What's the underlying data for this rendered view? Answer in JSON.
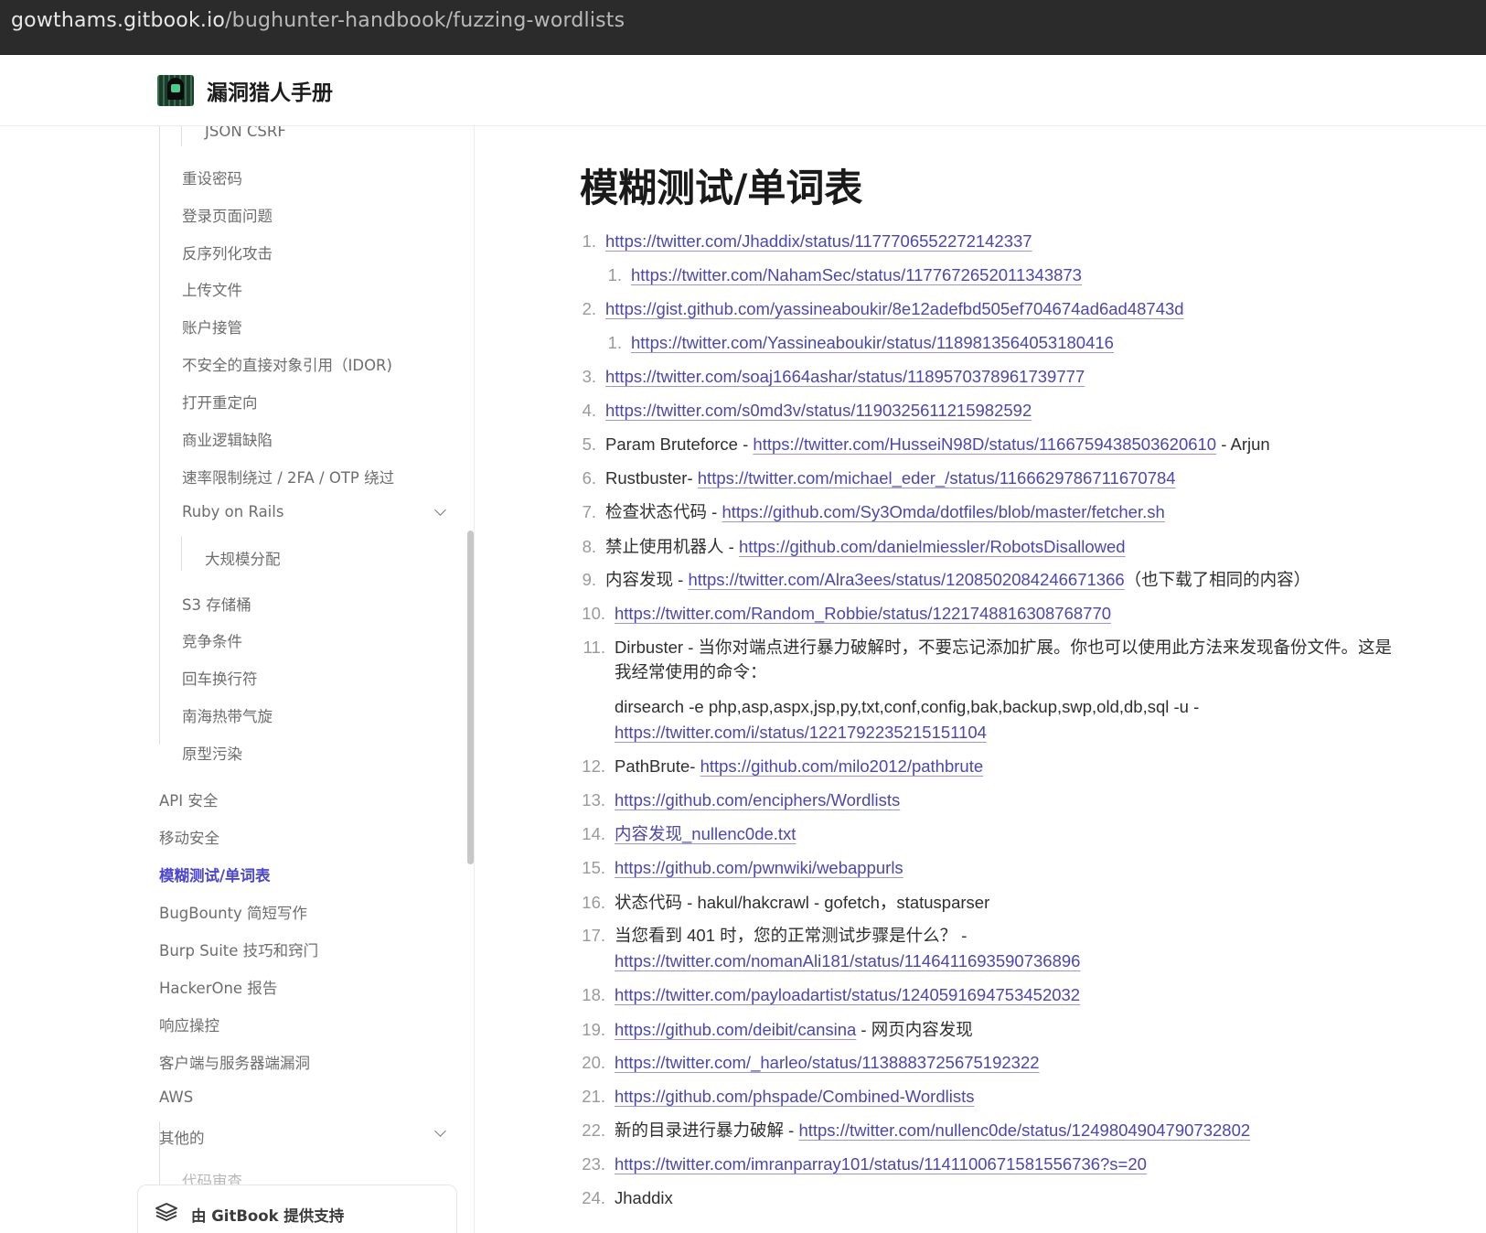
{
  "browser": {
    "url_host": "gowthams.gitbook.io",
    "url_path": "/bughunter-handbook/fuzzing-wordlists"
  },
  "header": {
    "logo_icon": "hooded-hacker-logo-icon",
    "site_title": "漏洞猎人手册"
  },
  "sidebar": {
    "items": [
      {
        "label": "JSON CSRF"
      },
      {
        "label": "重设密码"
      },
      {
        "label": "登录页面问题"
      },
      {
        "label": "反序列化攻击"
      },
      {
        "label": "上传文件"
      },
      {
        "label": "账户接管"
      },
      {
        "label": "不安全的直接对象引用（IDOR)"
      },
      {
        "label": "打开重定向"
      },
      {
        "label": "商业逻辑缺陷"
      },
      {
        "label": "速率限制绕过 / 2FA / OTP 绕过"
      },
      {
        "label": "Ruby on Rails"
      },
      {
        "label": "大规模分配"
      },
      {
        "label": "S3 存储桶"
      },
      {
        "label": "竞争条件"
      },
      {
        "label": "回车换行符"
      },
      {
        "label": "南海热带气旋"
      },
      {
        "label": "原型污染"
      },
      {
        "label": "API 安全"
      },
      {
        "label": "移动安全"
      },
      {
        "label": "模糊测试/单词表"
      },
      {
        "label": "BugBounty 简短写作"
      },
      {
        "label": "Burp Suite 技巧和窍门"
      },
      {
        "label": "HackerOne 报告"
      },
      {
        "label": "响应操控"
      },
      {
        "label": "客户端与服务器端漏洞"
      },
      {
        "label": "AWS"
      },
      {
        "label": "其他的"
      },
      {
        "label": "代码审查"
      }
    ],
    "powered_by": "由 GitBook 提供支持"
  },
  "main": {
    "title": "模糊测试/单词表",
    "list": [
      {
        "n": "1.",
        "parts": [
          {
            "link": "https://twitter.com/Jhaddix/status/1177706552272142337"
          }
        ]
      },
      {
        "n": "1.",
        "sub": true,
        "parts": [
          {
            "link": "https://twitter.com/NahamSec/status/1177672652011343873"
          }
        ]
      },
      {
        "n": "2.",
        "parts": [
          {
            "link": "https://gist.github.com/yassineaboukir/8e12adefbd505ef704674ad6ad48743d"
          }
        ]
      },
      {
        "n": "1.",
        "sub": true,
        "parts": [
          {
            "link": "https://twitter.com/Yassineaboukir/status/1189813564053180416"
          }
        ]
      },
      {
        "n": "3.",
        "parts": [
          {
            "link": "https://twitter.com/soaj1664ashar/status/1189570378961739777"
          }
        ]
      },
      {
        "n": "4.",
        "parts": [
          {
            "link": "https://twitter.com/s0md3v/status/1190325611215982592"
          }
        ]
      },
      {
        "n": "5.",
        "parts": [
          {
            "text": "Param Bruteforce - "
          },
          {
            "link": "https://twitter.com/HusseiN98D/status/1166759438503620610"
          },
          {
            "text": " - Arjun"
          }
        ]
      },
      {
        "n": "6.",
        "parts": [
          {
            "text": "Rustbuster- "
          },
          {
            "link": "https://twitter.com/michael_eder_/status/1166629786711670784"
          }
        ]
      },
      {
        "n": "7.",
        "parts": [
          {
            "text": "检查状态代码 - "
          },
          {
            "link": "https://github.com/Sy3Omda/dotfiles/blob/master/fetcher.sh"
          }
        ]
      },
      {
        "n": "8.",
        "parts": [
          {
            "text": "禁止使用机器人 - "
          },
          {
            "link": "https://github.com/danielmiessler/RobotsDisallowed"
          }
        ]
      },
      {
        "n": "9.",
        "parts": [
          {
            "text": "内容发现 - "
          },
          {
            "link": "https://twitter.com/Alra3ees/status/1208502084246671366"
          },
          {
            "text": "（也下载了相同的内容）"
          }
        ]
      },
      {
        "n": "10.",
        "parts": [
          {
            "link": "https://twitter.com/Random_Robbie/status/1221748816308768770"
          }
        ]
      },
      {
        "n": "11.",
        "parts": [
          {
            "text": "Dirbuster - 当你对端点进行暴力破解时，不要忘记添加扩展。你也可以使用此方法来发现备份文件。这是"
          }
        ]
      },
      {
        "n": "",
        "cont": true,
        "parts": [
          {
            "text": "我经常使用的命令："
          }
        ]
      },
      {
        "n": "",
        "cont": true,
        "parts": [
          {
            "text": "dirsearch -e php,asp,aspx,jsp,py,txt,conf,config,bak,backup,swp,old,db,sql -u -"
          }
        ]
      },
      {
        "n": "",
        "cont": true,
        "parts": [
          {
            "link": "https://twitter.com/i/status/1221792235215151104"
          }
        ]
      },
      {
        "n": "12.",
        "parts": [
          {
            "text": "PathBrute- "
          },
          {
            "link": "https://github.com/milo2012/pathbrute"
          }
        ]
      },
      {
        "n": "13.",
        "parts": [
          {
            "link": "https://github.com/enciphers/Wordlists"
          }
        ]
      },
      {
        "n": "14.",
        "parts": [
          {
            "link": "内容发现_nullenc0de.txt"
          }
        ]
      },
      {
        "n": "15.",
        "parts": [
          {
            "link": "https://github.com/pwnwiki/webappurls"
          }
        ]
      },
      {
        "n": "16.",
        "parts": [
          {
            "text": "状态代码 - hakul/hakcrawl - gofetch，statusparser"
          }
        ]
      },
      {
        "n": "17.",
        "parts": [
          {
            "text": "当您看到 401 时，您的正常测试步骤是什么？ -"
          }
        ]
      },
      {
        "n": "",
        "cont": true,
        "parts": [
          {
            "link": "https://twitter.com/nomanAli181/status/1146411693590736896"
          }
        ]
      },
      {
        "n": "18.",
        "parts": [
          {
            "link": "https://twitter.com/payloadartist/status/1240591694753452032"
          }
        ]
      },
      {
        "n": "19.",
        "parts": [
          {
            "link": "https://github.com/deibit/cansina"
          },
          {
            "text": " - 网页内容发现"
          }
        ]
      },
      {
        "n": "20.",
        "parts": [
          {
            "link": "https://twitter.com/_harleo/status/1138883725675192322"
          }
        ]
      },
      {
        "n": "21.",
        "parts": [
          {
            "link": "https://github.com/phspade/Combined-Wordlists"
          }
        ]
      },
      {
        "n": "22.",
        "parts": [
          {
            "text": "新的目录进行暴力破解 - "
          },
          {
            "link": "https://twitter.com/nullenc0de/status/1249804904790732802"
          }
        ]
      },
      {
        "n": "23.",
        "parts": [
          {
            "link": "https://twitter.com/imranparray101/status/1141100671581556736?s=20"
          }
        ]
      },
      {
        "n": "24.",
        "parts": [
          {
            "text": "Jhaddix"
          }
        ]
      }
    ]
  }
}
